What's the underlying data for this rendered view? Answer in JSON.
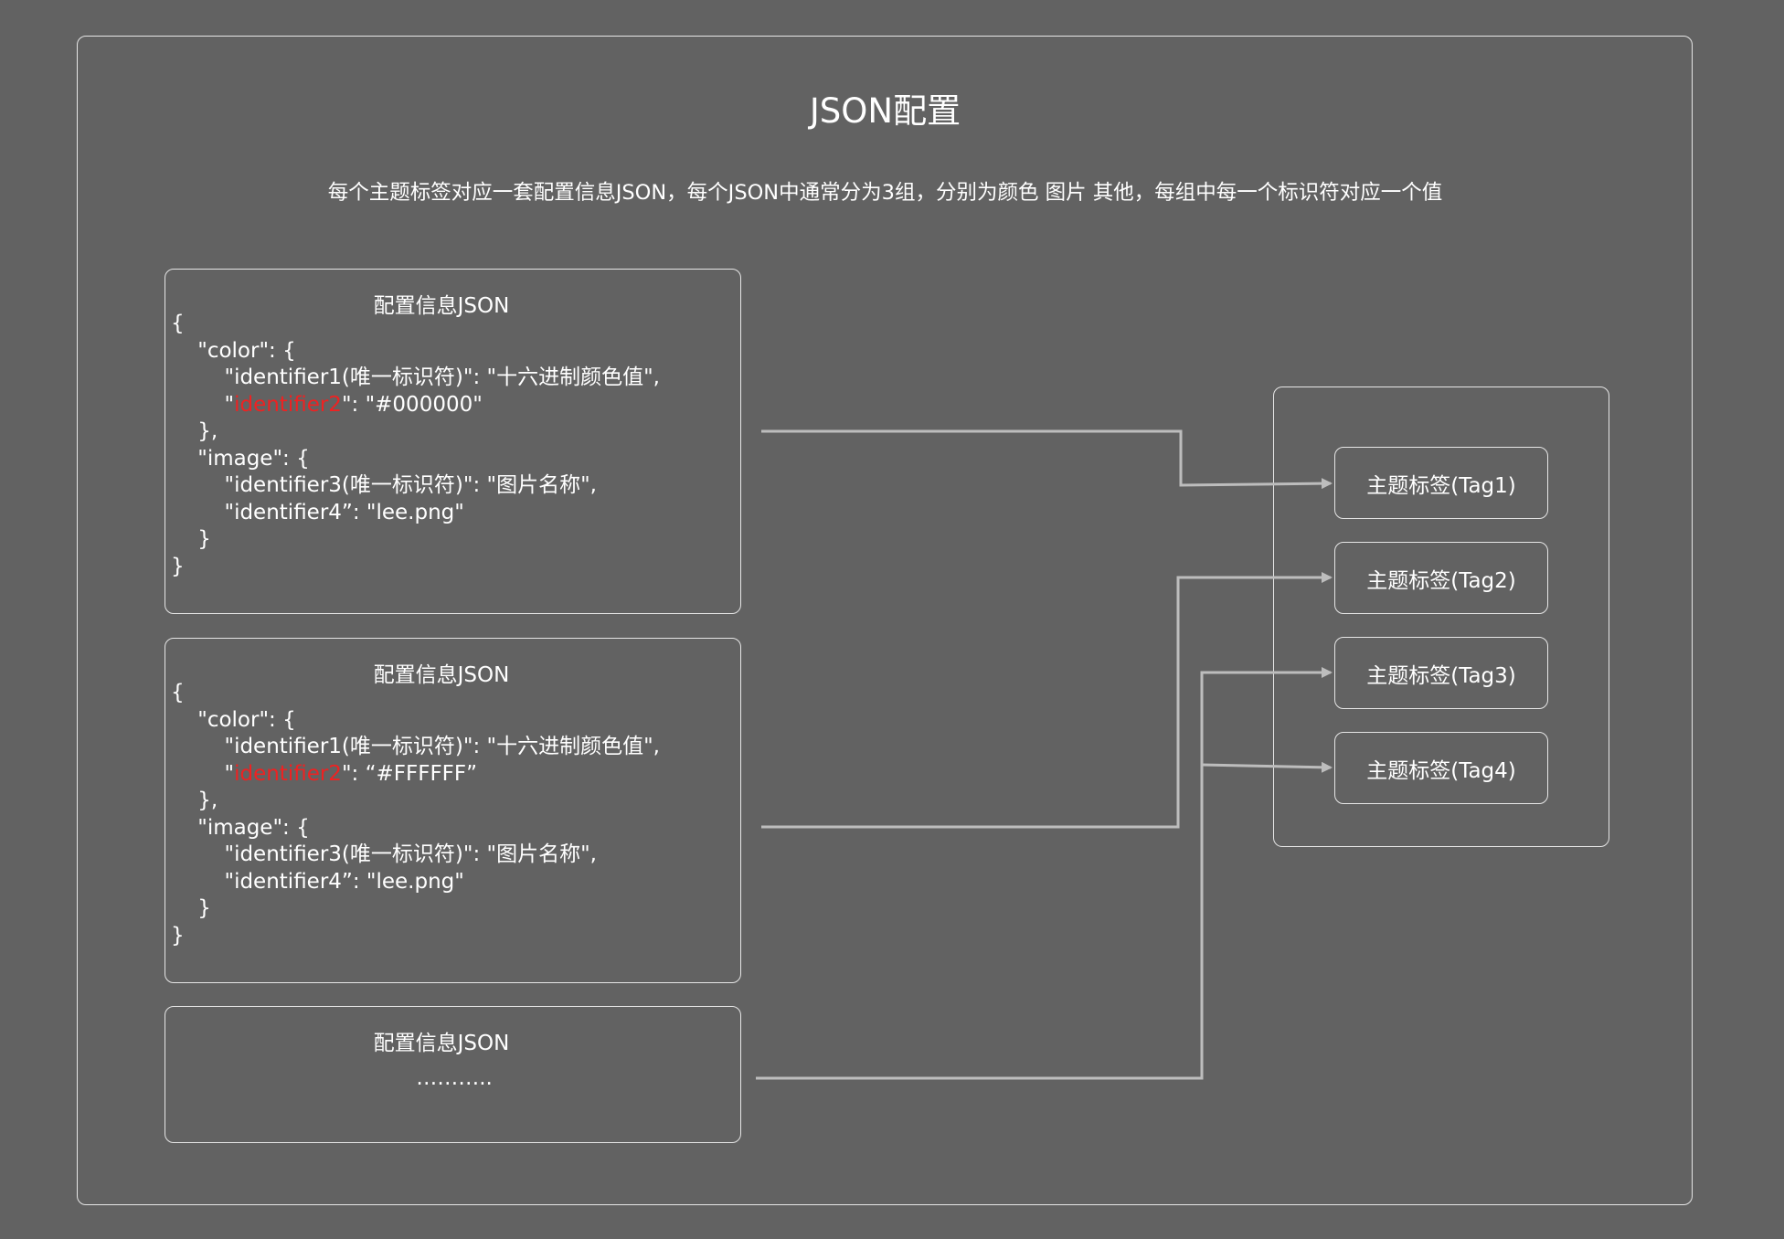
{
  "diagram": {
    "title": "JSON配置",
    "subtitle": "每个主题标签对应一套配置信息JSON，每个JSON中通常分为3组，分别为颜色 图片 其他，每组中每一个标识符对应一个值",
    "config_boxes": [
      {
        "title": "配置信息JSON",
        "code": {
          "open": "{",
          "color_open": "    \"color\": {",
          "id1": "        \"identifier1(唯一标识符)\": \"十六进制颜色值\",",
          "id2_prefix": "        \"",
          "id2_name": "identifier2",
          "id2_suffix": "\": \"#000000\"",
          "color_close": "    },",
          "image_open": "    \"image\": {",
          "id3": "        \"identifier3(唯一标识符)\": \"图片名称\",",
          "id4": "        \"identifier4”: \"lee.png\"",
          "image_close": "    }",
          "close": "}"
        }
      },
      {
        "title": "配置信息JSON",
        "code": {
          "open": "{",
          "color_open": "    \"color\": {",
          "id1": "        \"identifier1(唯一标识符)\": \"十六进制颜色值\",",
          "id2_prefix": "        \"",
          "id2_name": "identifier2",
          "id2_suffix": "\": “#FFFFFF”",
          "color_close": "    },",
          "image_open": "    \"image\": {",
          "id3": "        \"identifier3(唯一标识符)\": \"图片名称\",",
          "id4": "        \"identifier4”: \"lee.png\"",
          "image_close": "    }",
          "close": "}"
        }
      },
      {
        "title": "配置信息JSON",
        "ellipsis": "……….."
      }
    ],
    "tags": [
      {
        "label": "主题标签(Tag1)"
      },
      {
        "label": "主题标签(Tag2)"
      },
      {
        "label": "主题标签(Tag3)"
      },
      {
        "label": "主题标签(Tag4)"
      }
    ],
    "colors": {
      "background": "#626262",
      "stroke": "#e6e6e6",
      "connector": "#bdbdbd",
      "highlight": "#ee2222",
      "text": "#ffffff"
    }
  }
}
